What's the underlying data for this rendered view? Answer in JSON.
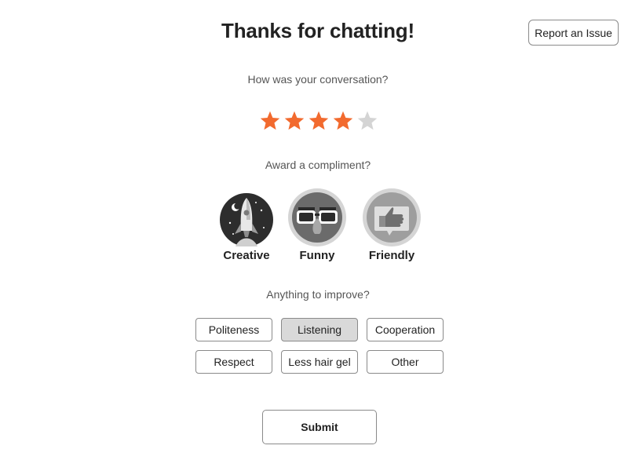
{
  "header": {
    "title": "Thanks for chatting!",
    "report_label": "Report an Issue"
  },
  "rating": {
    "prompt": "How was your conversation?",
    "value": 4,
    "max": 5,
    "active_color": "#f26a2e",
    "inactive_color": "#d4d4d4"
  },
  "compliments": {
    "prompt": "Award a compliment?",
    "items": [
      {
        "label": "Creative",
        "icon": "rocket-icon",
        "selected": true
      },
      {
        "label": "Funny",
        "icon": "disguise-glasses-icon",
        "selected": false
      },
      {
        "label": "Friendly",
        "icon": "thumbs-up-icon",
        "selected": false
      }
    ]
  },
  "improve": {
    "prompt": "Anything to improve?",
    "options": [
      {
        "label": "Politeness",
        "selected": false
      },
      {
        "label": "Listening",
        "selected": true
      },
      {
        "label": "Cooperation",
        "selected": false
      },
      {
        "label": "Respect",
        "selected": false
      },
      {
        "label": "Less hair gel",
        "selected": false
      },
      {
        "label": "Other",
        "selected": false
      }
    ]
  },
  "submit_label": "Submit"
}
